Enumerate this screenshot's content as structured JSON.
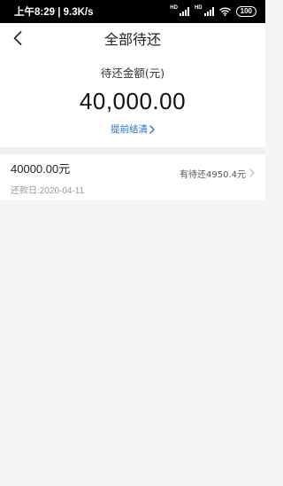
{
  "status_bar": {
    "time_speed": "上午8:29 | 9.3K/s",
    "hd1": "HD",
    "hd2": "HD",
    "battery": "100"
  },
  "nav": {
    "title": "全部待还"
  },
  "summary": {
    "label": "待还金额(元)",
    "amount": "40,000.00",
    "link": "提前结清"
  },
  "bills": [
    {
      "amount": "40000.00元",
      "due_date": "还款日:2020-04-11",
      "pending": "有待还4950.4元"
    }
  ],
  "colors": {
    "accent": "#2c6fd6",
    "background": "#f5f5f7",
    "status_bar": "#000000"
  }
}
